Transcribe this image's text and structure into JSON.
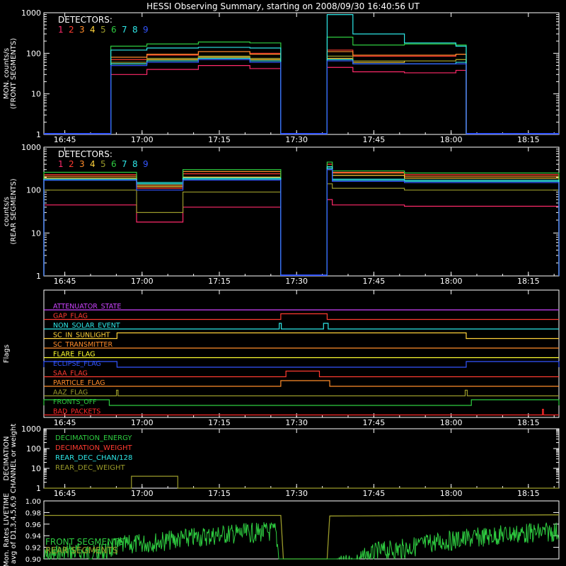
{
  "title": "HESSI Observing Summary, starting on 2008/09/30 16:40:56 UT",
  "colors": {
    "background": "#000000",
    "axes": "#ffffff",
    "det1": "#ff2a6a",
    "det2": "#ff3b30",
    "det3": "#ff8c2a",
    "det4": "#ffd23a",
    "det5": "#9a9a2a",
    "det6": "#2ecc40",
    "det7": "#2ee8e8",
    "det8": "#2ee8e8",
    "det9": "#3355ff",
    "white": "#ffffff"
  },
  "chart_data": [
    {
      "id": "front",
      "type": "line",
      "ylabel_lines": [
        "MON. counts/s",
        "(FRONT SEGMENTS)"
      ],
      "yscale": "log",
      "ylim": [
        1,
        1000
      ],
      "y_ticks": [
        "1",
        "10",
        "100",
        "1000"
      ],
      "xlim_minutes": [
        0,
        100
      ],
      "x_ticks": [
        "16:45",
        "17:00",
        "17:15",
        "17:30",
        "17:45",
        "18:00",
        "18:15"
      ],
      "legend_title": "DETECTORS:",
      "legend_numbers": [
        "1",
        "2",
        "3",
        "4",
        "5",
        "6",
        "7",
        "8",
        "9"
      ],
      "legend_placement": "top-left",
      "data_gaps": [
        [
          0,
          13
        ],
        [
          46,
          55
        ],
        [
          82,
          100
        ]
      ],
      "series": [
        {
          "name": "1",
          "color_key": "det1",
          "x": [
            13,
            20,
            30,
            40,
            46,
            55,
            60,
            70,
            80,
            82
          ],
          "y": [
            30,
            40,
            50,
            42,
            38,
            45,
            35,
            33,
            38,
            25
          ]
        },
        {
          "name": "2",
          "color_key": "det2",
          "x": [
            13,
            20,
            30,
            40,
            46,
            55,
            60,
            70,
            80,
            82
          ],
          "y": [
            70,
            90,
            110,
            100,
            95,
            120,
            85,
            85,
            95,
            60
          ]
        },
        {
          "name": "3",
          "color_key": "det3",
          "x": [
            13,
            20,
            30,
            40,
            46,
            55,
            60,
            70,
            80,
            82
          ],
          "y": [
            80,
            95,
            110,
            95,
            90,
            110,
            90,
            90,
            95,
            60
          ]
        },
        {
          "name": "4",
          "color_key": "det4",
          "x": [
            13,
            20,
            30,
            40,
            46,
            55,
            60,
            70,
            80,
            82
          ],
          "y": [
            55,
            70,
            80,
            70,
            65,
            75,
            60,
            65,
            70,
            45
          ]
        },
        {
          "name": "5",
          "color_key": "det5",
          "x": [
            13,
            20,
            30,
            40,
            46,
            55,
            60,
            70,
            80,
            82
          ],
          "y": [
            60,
            75,
            85,
            75,
            70,
            85,
            65,
            65,
            70,
            45
          ]
        },
        {
          "name": "6",
          "color_key": "det6",
          "x": [
            13,
            20,
            30,
            40,
            46,
            55,
            60,
            70,
            80,
            82
          ],
          "y": [
            150,
            170,
            190,
            180,
            170,
            250,
            160,
            170,
            160,
            120
          ]
        },
        {
          "name": "7",
          "color_key": "det7",
          "x": [
            13,
            20,
            30,
            40,
            46,
            55,
            60,
            70,
            80,
            82
          ],
          "y": [
            120,
            135,
            140,
            135,
            130,
            900,
            300,
            180,
            150,
            110
          ]
        },
        {
          "name": "8",
          "color_key": "det8",
          "x": [
            13,
            20,
            30,
            40,
            46,
            55,
            60,
            70,
            80,
            82
          ],
          "y": [
            55,
            65,
            75,
            65,
            60,
            70,
            55,
            55,
            60,
            40
          ]
        },
        {
          "name": "9",
          "color_key": "det9",
          "x": [
            13,
            20,
            30,
            40,
            46,
            55,
            60,
            70,
            80,
            82
          ],
          "y": [
            50,
            60,
            70,
            60,
            55,
            65,
            55,
            55,
            55,
            40
          ]
        }
      ]
    },
    {
      "id": "rear",
      "type": "line",
      "ylabel_lines": [
        "counts/s",
        "(REAR SEGMENTS)"
      ],
      "yscale": "log",
      "ylim": [
        1,
        1000
      ],
      "y_ticks": [
        "1",
        "10",
        "100",
        "1000"
      ],
      "xlim_minutes": [
        0,
        100
      ],
      "x_ticks": [
        "16:45",
        "17:00",
        "17:15",
        "17:30",
        "17:45",
        "18:00",
        "18:15"
      ],
      "legend_title": "DETECTORS:",
      "legend_numbers": [
        "1",
        "2",
        "3",
        "4",
        "5",
        "6",
        "7",
        "8",
        "9"
      ],
      "legend_placement": "top-left",
      "data_gaps": [
        [
          46,
          55
        ]
      ],
      "series": [
        {
          "name": "1",
          "color_key": "det1",
          "x": [
            0,
            17,
            18,
            26,
            27,
            46,
            55,
            56,
            70,
            100
          ],
          "y": [
            45,
            45,
            18,
            18,
            40,
            40,
            60,
            45,
            42,
            35
          ]
        },
        {
          "name": "2",
          "color_key": "det2",
          "x": [
            0,
            17,
            18,
            26,
            27,
            46,
            55,
            56,
            70,
            100
          ],
          "y": [
            230,
            230,
            110,
            110,
            240,
            230,
            400,
            260,
            230,
            220
          ]
        },
        {
          "name": "3",
          "color_key": "det3",
          "x": [
            0,
            17,
            18,
            26,
            27,
            46,
            55,
            56,
            70,
            100
          ],
          "y": [
            210,
            210,
            130,
            130,
            270,
            220,
            350,
            250,
            210,
            200
          ]
        },
        {
          "name": "4",
          "color_key": "det4",
          "x": [
            0,
            17,
            18,
            26,
            27,
            46,
            55,
            56,
            70,
            100
          ],
          "y": [
            190,
            190,
            120,
            120,
            200,
            190,
            300,
            220,
            190,
            180
          ]
        },
        {
          "name": "5",
          "color_key": "det5",
          "x": [
            0,
            17,
            18,
            26,
            27,
            46,
            55,
            56,
            70,
            100
          ],
          "y": [
            100,
            100,
            30,
            30,
            90,
            90,
            140,
            110,
            100,
            90
          ]
        },
        {
          "name": "6",
          "color_key": "det6",
          "x": [
            0,
            17,
            18,
            26,
            27,
            46,
            55,
            56,
            70,
            100
          ],
          "y": [
            260,
            260,
            140,
            140,
            300,
            240,
            450,
            280,
            250,
            240
          ]
        },
        {
          "name": "7",
          "color_key": "det7",
          "x": [
            0,
            17,
            18,
            26,
            27,
            46,
            55,
            56,
            70,
            100
          ],
          "y": [
            170,
            170,
            150,
            150,
            190,
            170,
            350,
            180,
            170,
            165
          ]
        },
        {
          "name": "8",
          "color_key": "det8",
          "x": [
            0,
            17,
            18,
            26,
            27,
            46,
            55,
            56,
            70,
            100
          ],
          "y": [
            180,
            180,
            140,
            140,
            180,
            170,
            320,
            170,
            160,
            160
          ]
        },
        {
          "name": "9",
          "color_key": "det9",
          "x": [
            0,
            17,
            18,
            26,
            27,
            46,
            55,
            56,
            70,
            100
          ],
          "y": [
            170,
            170,
            100,
            100,
            170,
            160,
            300,
            160,
            150,
            150
          ]
        }
      ]
    },
    {
      "id": "flags",
      "type": "line",
      "ylabel_lines": [
        "Flags"
      ],
      "xlim_minutes": [
        0,
        100
      ],
      "x_ticks": [
        "16:45",
        "17:00",
        "17:15",
        "17:30",
        "17:45",
        "18:00",
        "18:15"
      ],
      "flags": [
        {
          "label": "ATTENUATOR_STATE",
          "color": "#cc44ff",
          "intervals": []
        },
        {
          "label": "GAP_FLAG",
          "color": "#ff3b30",
          "intervals": [
            [
              46,
              55
            ]
          ]
        },
        {
          "label": "NON_SOLAR_EVENT",
          "color": "#2ee8e8",
          "intervals": [
            [
              45.7,
              46.1
            ],
            [
              54.3,
              55.2
            ]
          ]
        },
        {
          "label": "SC_IN_SUNLIGHT",
          "color": "#ffd23a",
          "intervals": [
            [
              14.2,
              82
            ]
          ]
        },
        {
          "label": "SC_TRANSMITTER",
          "color": "#ff8c2a",
          "intervals": []
        },
        {
          "label": "FLARE_FLAG",
          "color": "#ffff30",
          "intervals": []
        },
        {
          "label": "ECLIPSE_FLAG",
          "color": "#3355ff",
          "intervals": [
            [
              0,
              14.2
            ],
            [
              82,
              100
            ]
          ]
        },
        {
          "label": "SAA_FLAG",
          "color": "#ff3b30",
          "intervals": [
            [
              47,
              53.5
            ]
          ]
        },
        {
          "label": "PARTICLE_FLAG",
          "color": "#ff8c2a",
          "intervals": [
            [
              46,
              55.5
            ]
          ]
        },
        {
          "label": "AAZ_FLAG",
          "color": "#9a9a2a",
          "intervals": [
            [
              14.1,
              14.4
            ],
            [
              81.8,
              82.2
            ]
          ]
        },
        {
          "label": "FRONTS_OFF",
          "color": "#2ecc40",
          "intervals": [
            [
              0,
              12.7
            ],
            [
              83,
              100
            ]
          ]
        },
        {
          "label": "BAD_PACKETS",
          "color": "#ff2a2a",
          "intervals": [
            [
              96.8,
              97
            ]
          ]
        }
      ]
    },
    {
      "id": "decimation",
      "type": "line",
      "ylabel_lines": [
        "DECIMATION",
        "CHANNEL or weight"
      ],
      "yscale": "log",
      "ylim": [
        1,
        1000
      ],
      "y_ticks": [
        "1",
        "10",
        "100",
        "1000"
      ],
      "xlim_minutes": [
        0,
        100
      ],
      "x_ticks": [
        "16:45",
        "17:00",
        "17:15",
        "17:30",
        "17:45",
        "18:00",
        "18:15"
      ],
      "legend": [
        {
          "label": "DECIMATION_ENERGY",
          "color": "#2ecc40"
        },
        {
          "label": "DECIMATION_WEIGHT",
          "color": "#ff3b30"
        },
        {
          "label": "REAR_DEC_CHAN/128",
          "color": "#2ee8e8"
        },
        {
          "label": "REAR_DEC_WEIGHT",
          "color": "#9a9a2a"
        }
      ],
      "series": [
        {
          "name": "REAR_DEC_WEIGHT",
          "color": "#9a9a2a",
          "x": [
            0,
            17,
            17,
            26,
            26,
            100
          ],
          "y": [
            1,
            1,
            4,
            4,
            1,
            1
          ]
        }
      ]
    },
    {
      "id": "livetime",
      "type": "line",
      "ylabel_lines": [
        "Mon. Rates LIVETIME",
        "avg of D1,3,4,5,6,9"
      ],
      "ylim": [
        0.9,
        1.0
      ],
      "y_ticks": [
        "0.90",
        "0.92",
        "0.94",
        "0.96",
        "0.98",
        "1.00"
      ],
      "xlim_minutes": [
        0,
        100
      ],
      "legend": [
        {
          "label": "FRONT SEGMENTS",
          "color": "#2ecc40"
        },
        {
          "label": "REAR SEGMENTS",
          "color": "#9a9a2a"
        }
      ],
      "series": [
        {
          "name": "FRONT SEGMENTS",
          "color": "#2ecc40",
          "x": [
            0,
            5,
            10,
            15,
            20,
            25,
            30,
            35,
            40,
            45,
            46,
            55,
            60,
            65,
            70,
            75,
            80,
            85,
            90,
            95,
            100
          ],
          "y": [
            0.92,
            0.93,
            0.925,
            0.94,
            0.945,
            0.95,
            0.955,
            0.96,
            0.962,
            0.965,
            0.9,
            0.9,
            0.91,
            0.93,
            0.935,
            0.945,
            0.95,
            0.955,
            0.96,
            0.962,
            0.965
          ]
        },
        {
          "name": "REAR SEGMENTS",
          "color": "#9a9a2a",
          "x": [
            0,
            46,
            46.5,
            55,
            55.5,
            100
          ],
          "y": [
            0.975,
            0.975,
            0.9,
            0.9,
            0.974,
            0.976
          ]
        }
      ]
    }
  ]
}
